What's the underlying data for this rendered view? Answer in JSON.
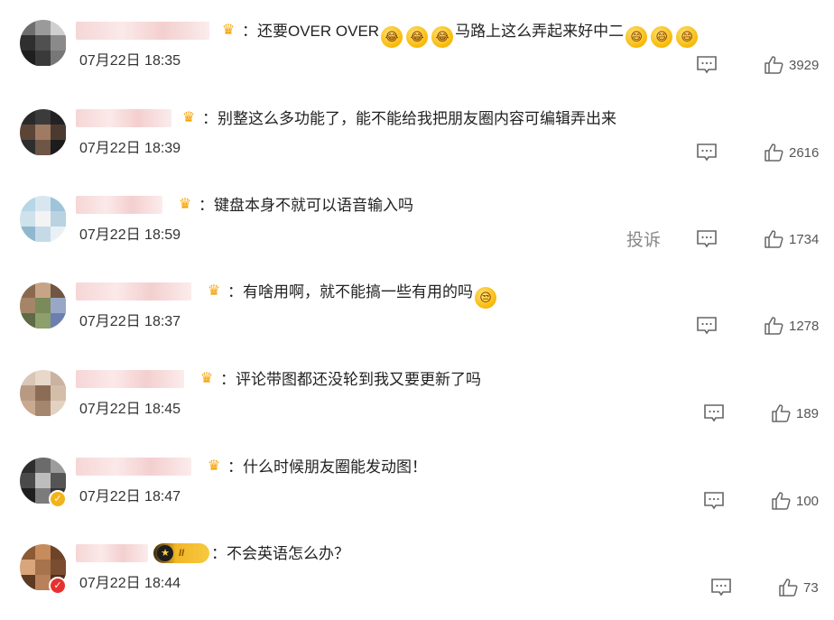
{
  "comments": [
    {
      "text": "：还要OVER OVER",
      "tail": "马路上这么弄起来好中二",
      "time": "07月22日 18:35",
      "likes": "3929"
    },
    {
      "text": "：别整这么多功能了，能不能给我把朋友圈内容可编辑弄出来",
      "time": "07月22日 18:39",
      "likes": "2616"
    },
    {
      "text": "：键盘本身不就可以语音输入吗",
      "time": "07月22日 18:59",
      "likes": "1734",
      "report_label": "投诉"
    },
    {
      "text": "：有啥用啊，就不能搞一些有用的吗",
      "time": "07月22日 18:37",
      "likes": "1278"
    },
    {
      "text": "：评论带图都还没轮到我又要更新了吗",
      "time": "07月22日 18:45",
      "likes": "189"
    },
    {
      "text": "：什么时候朋友圈能发动图！",
      "time": "07月22日 18:47",
      "likes": "100"
    },
    {
      "text": "：不会英语怎么办？",
      "time": "07月22日 18:44",
      "likes": "73",
      "vip_level": "II"
    }
  ],
  "icons": {
    "comment": "comment-icon",
    "like": "thumbs-up-icon",
    "member": "crown-icon",
    "emoji": "emoji-icon"
  },
  "colors": {
    "name_blur": "#f6d6d6",
    "crown": "#f4a000",
    "verified_yellow": "#f2b31b",
    "verified_red": "#e8312f"
  }
}
